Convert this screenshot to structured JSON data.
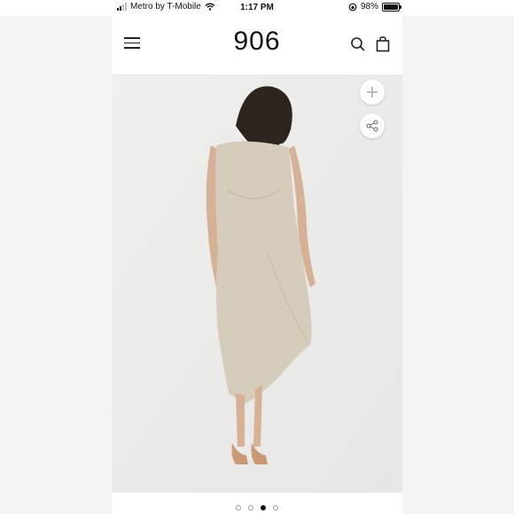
{
  "status_bar": {
    "carrier": "Metro by T-Mobile",
    "time": "1:17 PM",
    "battery_text": "98%",
    "battery_level": 0.98
  },
  "header": {
    "logo": "906",
    "menu_icon": "hamburger-menu-icon",
    "search_icon": "search-icon",
    "bag_icon": "shopping-bag-icon"
  },
  "product": {
    "image_alt": "Model wearing beige sleeveless asymmetric midi dress",
    "add_icon": "plus-icon",
    "share_icon": "share-icon",
    "dress_color": "#d6ccbc"
  },
  "carousel": {
    "count": 4,
    "active_index": 2
  }
}
